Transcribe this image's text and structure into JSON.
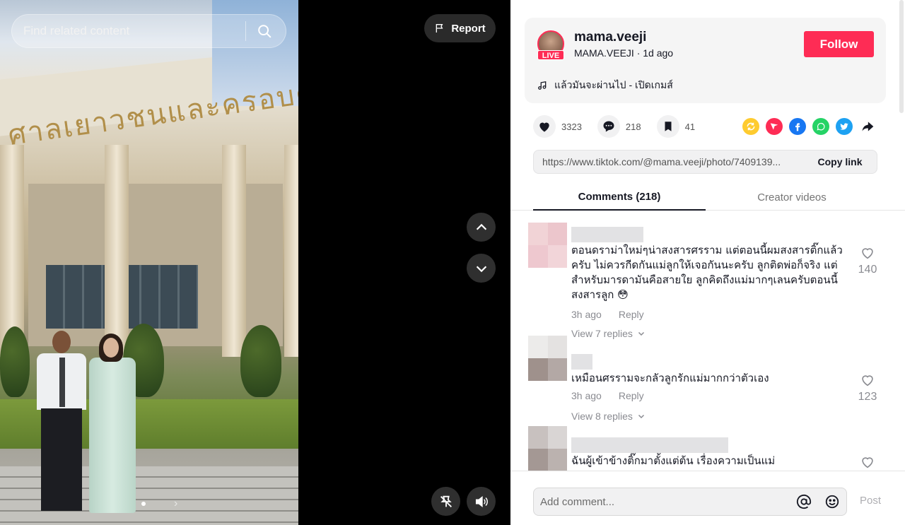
{
  "search": {
    "placeholder": "Find related content"
  },
  "media": {
    "sign_text": "ศาลเยาวชนและครอบครัวกลาง",
    "report_label": "Report",
    "carousel_next": "›"
  },
  "author": {
    "username": "mama.veeji",
    "display_name": "MAMA.VEEJI",
    "time_ago": "1d ago",
    "live_badge": "LIVE",
    "follow_label": "Follow",
    "music": "แล้วมันจะผ่านไป - เปิดเกมส์"
  },
  "stats": {
    "likes": "3323",
    "comments": "218",
    "saves": "41"
  },
  "share": {
    "link": "https://www.tiktok.com/@mama.veeji/photo/7409139...",
    "copy_label": "Copy link"
  },
  "tabs": {
    "comments_label": "Comments (218)",
    "creator_label": "Creator videos"
  },
  "comments": [
    {
      "text": "ตอนดราม่าใหม่ๆน่าสงสารศรราม แต่ตอนนี้ผมสงสารติ๊กแล้วครับ ไม่ควรกีดกันแม่ลูกให้เจอกันนะครับ ลูกติดพ่อก็จริง แต่สำหรับมารดามันคือสายใย ลูกคิดถึงแม่มากๆเลนครับตอนนี้ สงสารลูก 😳",
      "time": "3h ago",
      "reply_label": "Reply",
      "view_replies": "View 7 replies",
      "likes": "140"
    },
    {
      "text": "เหมือนศรรามจะกลัวลูกรักแม่มากกว่าตัวเอง",
      "time": "3h ago",
      "reply_label": "Reply",
      "view_replies": "View 8 replies",
      "likes": "123"
    },
    {
      "text": "ฉันผู้เข้าข้างติ๊กมาตั้งแต่ต้น เรื่องความเป็นแม่",
      "time": "",
      "reply_label": "",
      "view_replies": "",
      "likes": ""
    }
  ],
  "composer": {
    "placeholder": "Add comment...",
    "post_label": "Post"
  },
  "colors": {
    "accent": "#fe2c55",
    "text": "#161823",
    "muted": "#8a8b91"
  }
}
